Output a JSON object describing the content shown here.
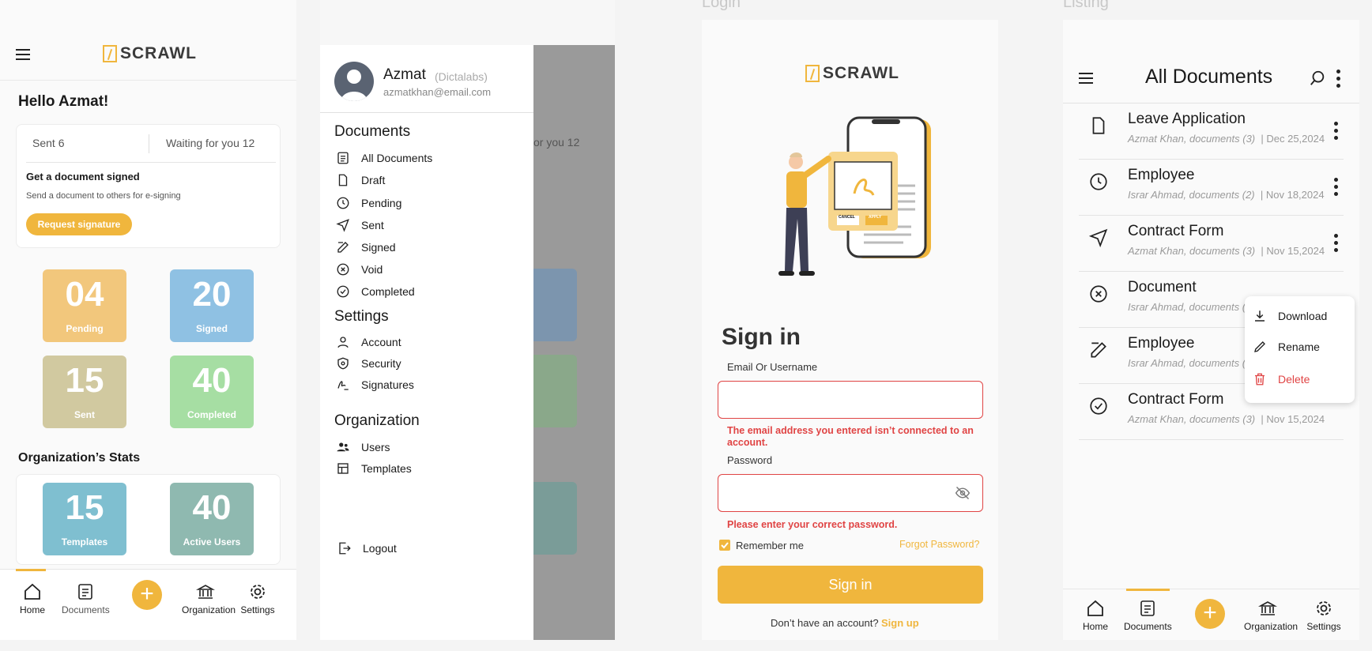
{
  "s1": {
    "logo": "SCRAWL",
    "greeting": "Hello Azmat!",
    "sent_tab": "Sent 6",
    "waiting_tab": "Waiting for you 12",
    "card_title": "Get a document signed",
    "card_sub": "Send a document to others for e-signing",
    "request_btn": "Request signature",
    "tiles": [
      {
        "num": "04",
        "label": "Pending",
        "color": "#f2c77c"
      },
      {
        "num": "20",
        "label": "Signed",
        "color": "#8fc1e3"
      },
      {
        "num": "15",
        "label": "Sent",
        "color": "#d1c9a0"
      },
      {
        "num": "40",
        "label": "Completed",
        "color": "#a6dea3"
      }
    ],
    "org_title": "Organization’s Stats",
    "org_tiles": [
      {
        "num": "15",
        "label": "Templates",
        "color": "#7fbfd0"
      },
      {
        "num": "40",
        "label": "Active Users",
        "color": "#8fb9b0"
      }
    ],
    "nav": [
      "Home",
      "Documents",
      "Organization",
      "Settings"
    ]
  },
  "s2": {
    "name": "Azmat",
    "org": "(Dictalabs)",
    "email": "azmatkhan@email.com",
    "documents_h": "Documents",
    "doc_items": [
      "All Documents",
      "Draft",
      "Pending",
      "Sent",
      "Signed",
      "Void",
      "Completed"
    ],
    "settings_h": "Settings",
    "settings_items": [
      "Account",
      "Security",
      "Signatures"
    ],
    "org_h": "Organization",
    "org_items": [
      "Users",
      "Templates"
    ],
    "logout": "Logout",
    "bg_waiting": "or you 12"
  },
  "s3": {
    "section": "Login",
    "logo": "SCRAWL",
    "title": "Sign in",
    "email_label": "Email Or Username",
    "email_error": "The email address you entered isn’t connected to an account.",
    "password_label": "Password",
    "password_error": "Please enter your correct password.",
    "remember": "Remember me",
    "forgot": "Forgot Password?",
    "signin_btn": "Sign in",
    "no_account": "Don’t have an account?",
    "signup": "Sign up",
    "cancel": "CANCEL",
    "apply": "APPLY"
  },
  "s4": {
    "section": "Listing",
    "title": "All Documents",
    "docs": [
      {
        "title": "Leave Application",
        "meta": "Azmat Khan, documents (3)",
        "date": "Dec 25,2024",
        "icon": "file-icon"
      },
      {
        "title": "Employee",
        "meta": "Israr Ahmad, documents (2)",
        "date": "Nov 18,2024",
        "icon": "clock-icon"
      },
      {
        "title": "Contract Form",
        "meta": "Azmat Khan, documents (3)",
        "date": "Nov 15,2024",
        "icon": "send-icon"
      },
      {
        "title": "Document",
        "meta": "Israr Ahmad, documents (5)",
        "date": "",
        "icon": "x-circle-icon"
      },
      {
        "title": "Employee",
        "meta": "Israr Ahmad, documents (2)",
        "date": "",
        "icon": "edit-icon"
      },
      {
        "title": "Contract Form",
        "meta": "Azmat Khan, documents (3)",
        "date": "Nov 15,2024",
        "icon": "check-circle-icon"
      }
    ],
    "menu": [
      "Download",
      "Rename",
      "Delete"
    ],
    "nav": [
      "Home",
      "Documents",
      "Organization",
      "Settings"
    ]
  },
  "colors": {
    "accent": "#f0b63d",
    "error": "#e04444"
  }
}
